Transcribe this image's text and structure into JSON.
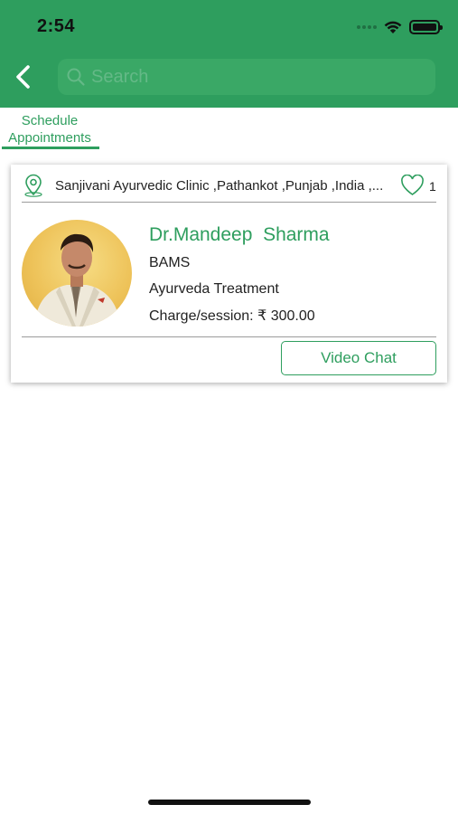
{
  "status_bar": {
    "time": "2:54"
  },
  "header": {
    "search_placeholder": "Search",
    "back_icon": "chevron-left-icon",
    "search_icon": "search-icon",
    "background_color": "#2e9e5e"
  },
  "tabs": [
    {
      "label": "Schedule\nAppointments",
      "active": true
    }
  ],
  "doctors": [
    {
      "clinic": "Sanjivani Ayurvedic Clinic ,Pathankot ,Punjab ,India ,...",
      "likes": "1",
      "name": "Dr.Mandeep  Sharma",
      "degree": "BAMS",
      "specialty": "Ayurveda Treatment",
      "charge": "Charge/session: ₹ 300.00",
      "action_label": "Video Chat"
    }
  ],
  "colors": {
    "accent": "#2e9e5e",
    "text": "#222222"
  }
}
